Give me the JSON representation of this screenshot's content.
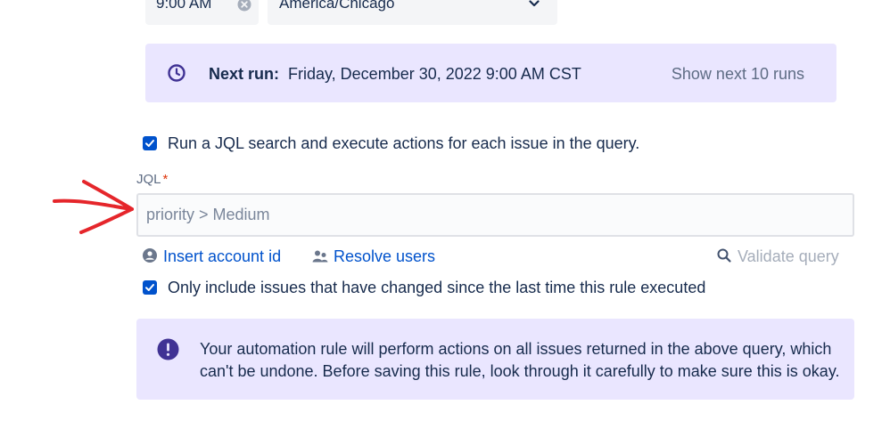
{
  "schedule": {
    "time_value": "9:00 AM",
    "timezone_value": "America/Chicago"
  },
  "next_run": {
    "label": "Next run:",
    "value": "Friday, December 30, 2022 9:00 AM CST",
    "show_runs_label": "Show next 10 runs"
  },
  "jql_option": {
    "checked": true,
    "label": "Run a JQL search and execute actions for each issue in the query."
  },
  "jql": {
    "label": "JQL",
    "required_marker": "*",
    "placeholder": "priority > Medium",
    "value": ""
  },
  "actions": {
    "insert_account_id": "Insert account id",
    "resolve_users": "Resolve users",
    "validate_query": "Validate query"
  },
  "changed_only_option": {
    "checked": true,
    "label": "Only include issues that have changed since the last time this rule executed"
  },
  "warning": {
    "text": "Your automation rule will perform actions on all issues returned in the above query, which can't be undone. Before saving this rule, look through it carefully to make sure this is okay."
  },
  "colors": {
    "accent": "#0052CC",
    "panel_bg": "#EAE6FF",
    "discovery_icon": "#403294",
    "annotation_arrow": "#E5262B"
  },
  "icons": [
    "clear-icon",
    "chevron-down-icon",
    "clock-icon",
    "check-icon",
    "person-icon",
    "people-icon",
    "search-icon",
    "exclamation-icon",
    "annotation-arrow"
  ]
}
